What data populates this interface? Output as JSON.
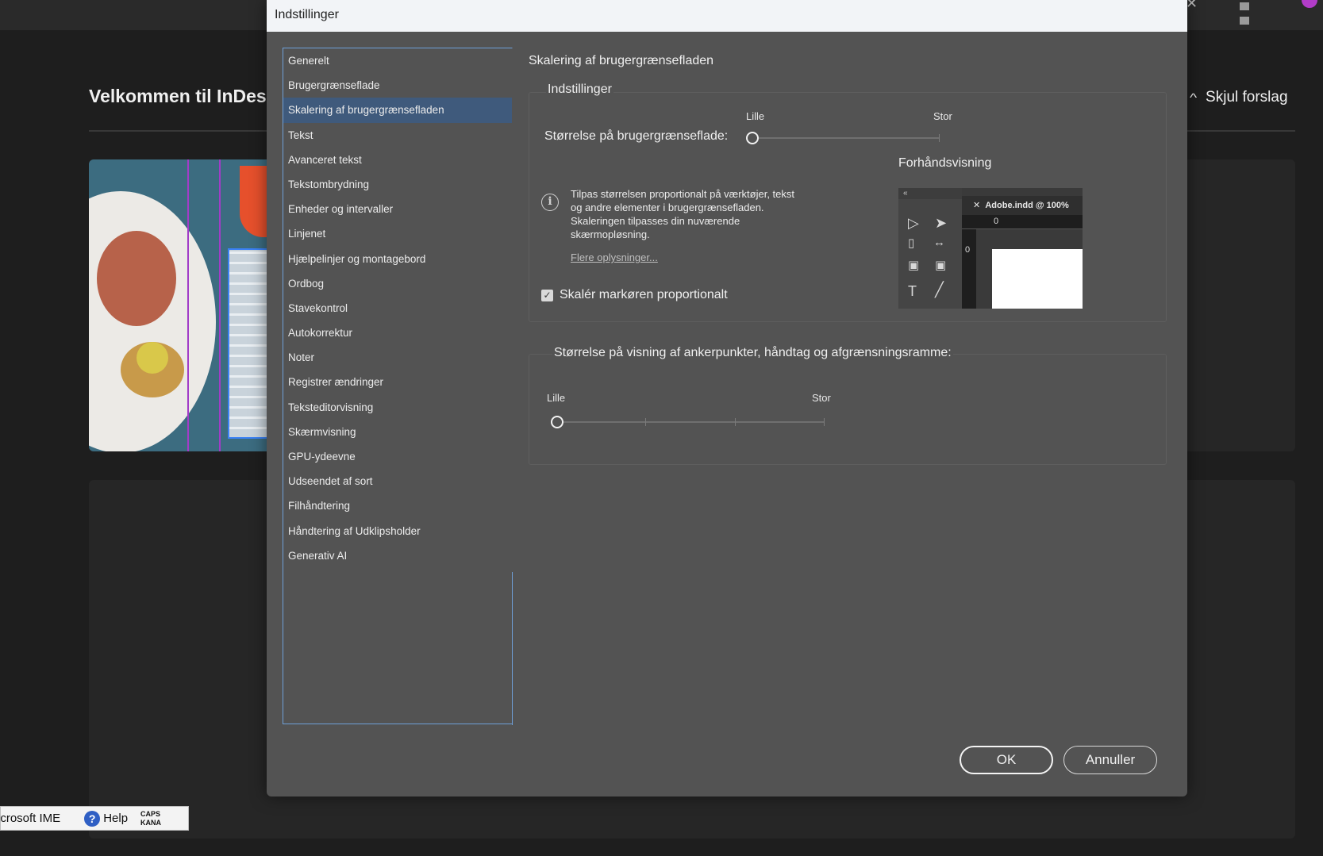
{
  "app": {
    "welcome_title": "Velkommen til InDesig",
    "hide_suggestions_label": "Skjul forslag"
  },
  "taskbar": {
    "ime_name": "icrosoft IME",
    "help_label": "Help",
    "caps_label": "CAPS",
    "kana_label": "KANA"
  },
  "dialog": {
    "title": "Indstillinger",
    "nav_items": [
      "Generelt",
      "Brugergrænseflade",
      "Skalering af brugergrænsefladen",
      "Tekst",
      "Avanceret tekst",
      "Tekstombrydning",
      "Enheder og intervaller",
      "Linjenet",
      "Hjælpelinjer og montagebord",
      "Ordbog",
      "Stavekontrol",
      "Autokorrektur",
      "Noter",
      "Registrer ændringer",
      "Teksteditorvisning",
      "Skærmvisning",
      "GPU-ydeevne",
      "Udseendet af sort",
      "Filhåndtering",
      "Håndtering af Udklipsholder",
      "Generativ AI"
    ],
    "active_nav_index": 2,
    "section_title": "Skalering af brugergrænsefladen",
    "settings_group": {
      "legend": "Indstillinger",
      "ui_size_label": "Størrelse på brugergrænseflade:",
      "slider_min_label": "Lille",
      "slider_max_label": "Stor",
      "slider_value": 0,
      "info_text": "Tilpas størrelsen proportionalt på værktøjer, tekst og andre elementer i brugergrænsefladen. Skaleringen tilpasses din nuværende skærmopløsning.",
      "info_link": "Flere oplysninger...",
      "scale_cursor_label": "Skalér markøren proportionalt",
      "scale_cursor_checked": true,
      "preview_label": "Forhåndsvisning",
      "preview_doc_tab": "Adobe.indd @ 100%",
      "preview_ruler_zero": "0"
    },
    "anchor_group": {
      "legend": "Størrelse på visning af ankerpunkter, håndtag og afgrænsningsramme:",
      "slider_min_label": "Lille",
      "slider_max_label": "Stor",
      "slider_value": 0
    },
    "buttons": {
      "ok": "OK",
      "cancel": "Annuller"
    }
  }
}
